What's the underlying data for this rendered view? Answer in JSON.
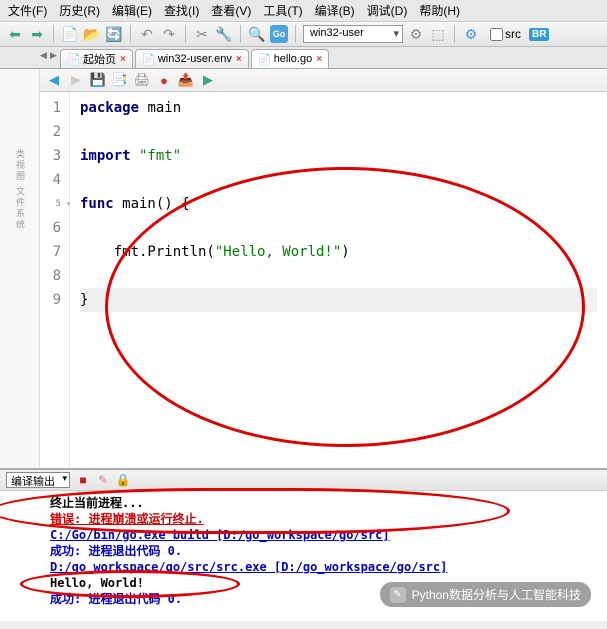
{
  "menu": {
    "file": "文件(F)",
    "history": "历史(R)",
    "edit": "编辑(E)",
    "find": "查找(I)",
    "view": "查看(V)",
    "tools": "工具(T)",
    "build": "编译(B)",
    "debug": "调试(D)",
    "help": "帮助(H)"
  },
  "toolbar": {
    "project_selected": "win32-user",
    "src_label": "src",
    "br_badge": "BR"
  },
  "tabs": [
    {
      "label": "起始页"
    },
    {
      "label": "win32-user.env"
    },
    {
      "label": "hello.go"
    }
  ],
  "gutter": [
    "1",
    "2",
    "3",
    "4",
    "5",
    "6",
    "7",
    "8",
    "9"
  ],
  "code": {
    "line1_kw": "package",
    "line1_rest": " main",
    "line3_kw": "import",
    "line3_str": " \"fmt\"",
    "line5_kw": "func",
    "line5_mid": " main() ",
    "line5_brace": "{",
    "line7_indent": "    fmt.Println(",
    "line7_str": "\"Hello, World!\"",
    "line7_end": ")",
    "line9": "}"
  },
  "output": {
    "selector": "编译输出",
    "l1": "终止当前进程...",
    "l2": "错误: 进程崩溃或运行终止.",
    "l3": "C:/Go/bin/go.exe build [D:/go_workspace/go/src]",
    "l4": "成功: 进程退出代码 0.",
    "l5": "D:/go_workspace/go/src/src.exe  [D:/go_workspace/go/src]",
    "l6": "Hello, World!",
    "l7": "成功: 进程退出代码 0."
  },
  "watermark": {
    "text": "Python数据分析与人工智能科技"
  }
}
